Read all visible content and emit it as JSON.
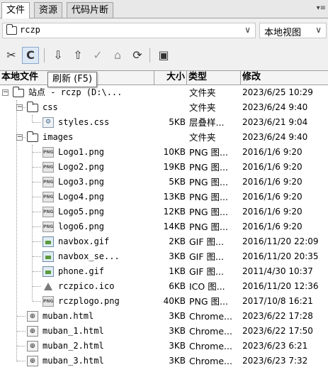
{
  "tabs": [
    {
      "label": "文件",
      "active": true
    },
    {
      "label": "资源",
      "active": false
    },
    {
      "label": "代码片断",
      "active": false
    }
  ],
  "tab_menu_icon": "menu-icon",
  "site_select": {
    "value": "rczp"
  },
  "view_select": {
    "value": "本地视图"
  },
  "tooltip": "刷新 (F5)",
  "columns": {
    "name": "本地文件",
    "size": "大小",
    "type": "类型",
    "modified": "修改"
  },
  "rows": [
    {
      "name": "站点 - rczp (D:\\...",
      "size": "",
      "type": "文件夹",
      "modified": "2023/6/25 10:29",
      "icon": "folder-icon",
      "level": 0,
      "toggle": "−"
    },
    {
      "name": "css",
      "size": "",
      "type": "文件夹",
      "modified": "2023/6/24 9:40",
      "icon": "folder-icon",
      "level": 1,
      "toggle": "−"
    },
    {
      "name": "styles.css",
      "size": "5KB",
      "type": "层叠样...",
      "modified": "2023/6/21 9:04",
      "icon": "css-file-icon",
      "level": 2,
      "toggle": ""
    },
    {
      "name": "images",
      "size": "",
      "type": "文件夹",
      "modified": "2023/6/24 9:40",
      "icon": "folder-icon",
      "level": 1,
      "toggle": "−"
    },
    {
      "name": "Logo1.png",
      "size": "10KB",
      "type": "PNG 图...",
      "modified": "2016/1/6 9:20",
      "icon": "png-file-icon",
      "level": 2,
      "toggle": ""
    },
    {
      "name": "Logo2.png",
      "size": "19KB",
      "type": "PNG 图...",
      "modified": "2016/1/6 9:20",
      "icon": "png-file-icon",
      "level": 2,
      "toggle": ""
    },
    {
      "name": "Logo3.png",
      "size": "5KB",
      "type": "PNG 图...",
      "modified": "2016/1/6 9:20",
      "icon": "png-file-icon",
      "level": 2,
      "toggle": ""
    },
    {
      "name": "Logo4.png",
      "size": "13KB",
      "type": "PNG 图...",
      "modified": "2016/1/6 9:20",
      "icon": "png-file-icon",
      "level": 2,
      "toggle": ""
    },
    {
      "name": "Logo5.png",
      "size": "12KB",
      "type": "PNG 图...",
      "modified": "2016/1/6 9:20",
      "icon": "png-file-icon",
      "level": 2,
      "toggle": ""
    },
    {
      "name": "logo6.png",
      "size": "14KB",
      "type": "PNG 图...",
      "modified": "2016/1/6 9:20",
      "icon": "png-file-icon",
      "level": 2,
      "toggle": ""
    },
    {
      "name": "navbox.gif",
      "size": "2KB",
      "type": "GIF 图...",
      "modified": "2016/11/20 22:09",
      "icon": "gif-file-icon",
      "level": 2,
      "toggle": ""
    },
    {
      "name": "navbox_se...",
      "size": "3KB",
      "type": "GIF 图...",
      "modified": "2016/11/20 20:35",
      "icon": "gif-file-icon",
      "level": 2,
      "toggle": ""
    },
    {
      "name": "phone.gif",
      "size": "1KB",
      "type": "GIF 图...",
      "modified": "2011/4/30 10:37",
      "icon": "gif-file-icon",
      "level": 2,
      "toggle": ""
    },
    {
      "name": "rczpico.ico",
      "size": "6KB",
      "type": "ICO 图...",
      "modified": "2016/11/20 12:36",
      "icon": "ico-file-icon",
      "level": 2,
      "toggle": ""
    },
    {
      "name": "rczplogo.png",
      "size": "40KB",
      "type": "PNG 图...",
      "modified": "2017/10/8 16:21",
      "icon": "png-file-icon",
      "level": 2,
      "toggle": ""
    },
    {
      "name": "muban.html",
      "size": "3KB",
      "type": "Chrome...",
      "modified": "2023/6/22 17:28",
      "icon": "html-file-icon",
      "level": 1,
      "toggle": ""
    },
    {
      "name": "muban_1.html",
      "size": "3KB",
      "type": "Chrome...",
      "modified": "2023/6/22 17:50",
      "icon": "html-file-icon",
      "level": 1,
      "toggle": ""
    },
    {
      "name": "muban_2.html",
      "size": "3KB",
      "type": "Chrome...",
      "modified": "2023/6/23 6:21",
      "icon": "html-file-icon",
      "level": 1,
      "toggle": ""
    },
    {
      "name": "muban_3.html",
      "size": "3KB",
      "type": "Chrome...",
      "modified": "2023/6/23 7:32",
      "icon": "html-file-icon",
      "level": 1,
      "toggle": ""
    }
  ],
  "toolbar_icons": [
    "connect-icon",
    "refresh-icon",
    "get-icon",
    "put-icon",
    "checkout-icon",
    "checkin-icon",
    "sync-icon",
    "expand-icon"
  ]
}
